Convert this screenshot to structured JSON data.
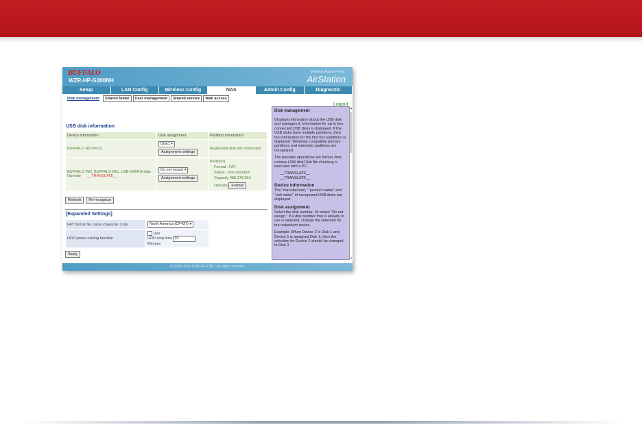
{
  "colors": {
    "banner": "#c41e24",
    "header": "#4f9cc4",
    "help_bg": "#c9c0e8",
    "accent_text": "#1b3f8a"
  },
  "brand": {
    "logo": "BUFFALO",
    "model": "WZR-HP-G300NH",
    "subtitle": "Wireless Access Point",
    "product": "AirStation"
  },
  "tabs": [
    "Setup",
    "LAN Config",
    "Wireless Config",
    "NAS",
    "Admin Config",
    "Diagnostic"
  ],
  "active_tab": "NAS",
  "subtabs": [
    "Disk management",
    "Shared folder",
    "User management",
    "Shared service",
    "Web access"
  ],
  "active_subtab": "Disk management",
  "logout": "Logout",
  "usb": {
    "title": "USB disk information",
    "headers": [
      "Device information",
      "Disk assignment",
      "Partition information"
    ],
    "row1": {
      "device": "BUFFALO HD-PFU2",
      "select": "Disk1",
      "button": "Assignment settings",
      "partition": "Registered disk not connected"
    },
    "row2": {
      "device": "BUFFALO INC. BUFFALO INC. USB-SATA Bridge",
      "operate_label": "Operate",
      "operate_value": "__TRANSLATE__",
      "select": "Do not mount",
      "button": "Assignment settings",
      "partition_name": "Partition1",
      "format": "Format : FAT",
      "status": "Status : Not mounted",
      "capacity": "Capacity 488,378,063",
      "operate2": "Operate",
      "format_button": "Format"
    }
  },
  "actions": {
    "refresh": "Refresh",
    "recognize": "Re-recognize"
  },
  "expanded": {
    "title": "[Expanded Settings]",
    "fat_label": "FAT format file name character code",
    "fat_value": "North America (CP437)",
    "hdd_label": "HDD power-saving function",
    "use_label": "Use",
    "stop_label": "HDD stop time",
    "stop_value": "10",
    "minutes": "Minutes"
  },
  "apply": "Apply",
  "footer": "(C)2000-2008 BUFFALO INC. All rights reserved.",
  "help": {
    "title": "Disk management",
    "p1": "Displays information about the USB disk and manages it. Information for up to four connected USB disks is displayed. If the USB disks have multiple partitions, then the information for the first four partitions is displayed. Windows compatible primary partitions and extended partitions are recognized.",
    "p2": "The possible operations are format. And remove USB disk Disk file checking is executed with a PC.",
    "t1": "__TRANSLATE__",
    "t2": "__TRANSLATE__",
    "h2": "Device information",
    "p3": "The \"manufacturer,\" \"product name\" and \"unit name\" of recognized USB disks are displayed.",
    "h3": "Disk assignment",
    "p4": "Select the disk number. Or select \"Do not assign.\" If a disk number that is already in use is selected, change the selection for the redundant device.",
    "p5": "Example: When Device 2 is Disk 1 and Device 1 is assigned Disk 1, then the selection for Device 2 should be changed to Disk 2."
  }
}
